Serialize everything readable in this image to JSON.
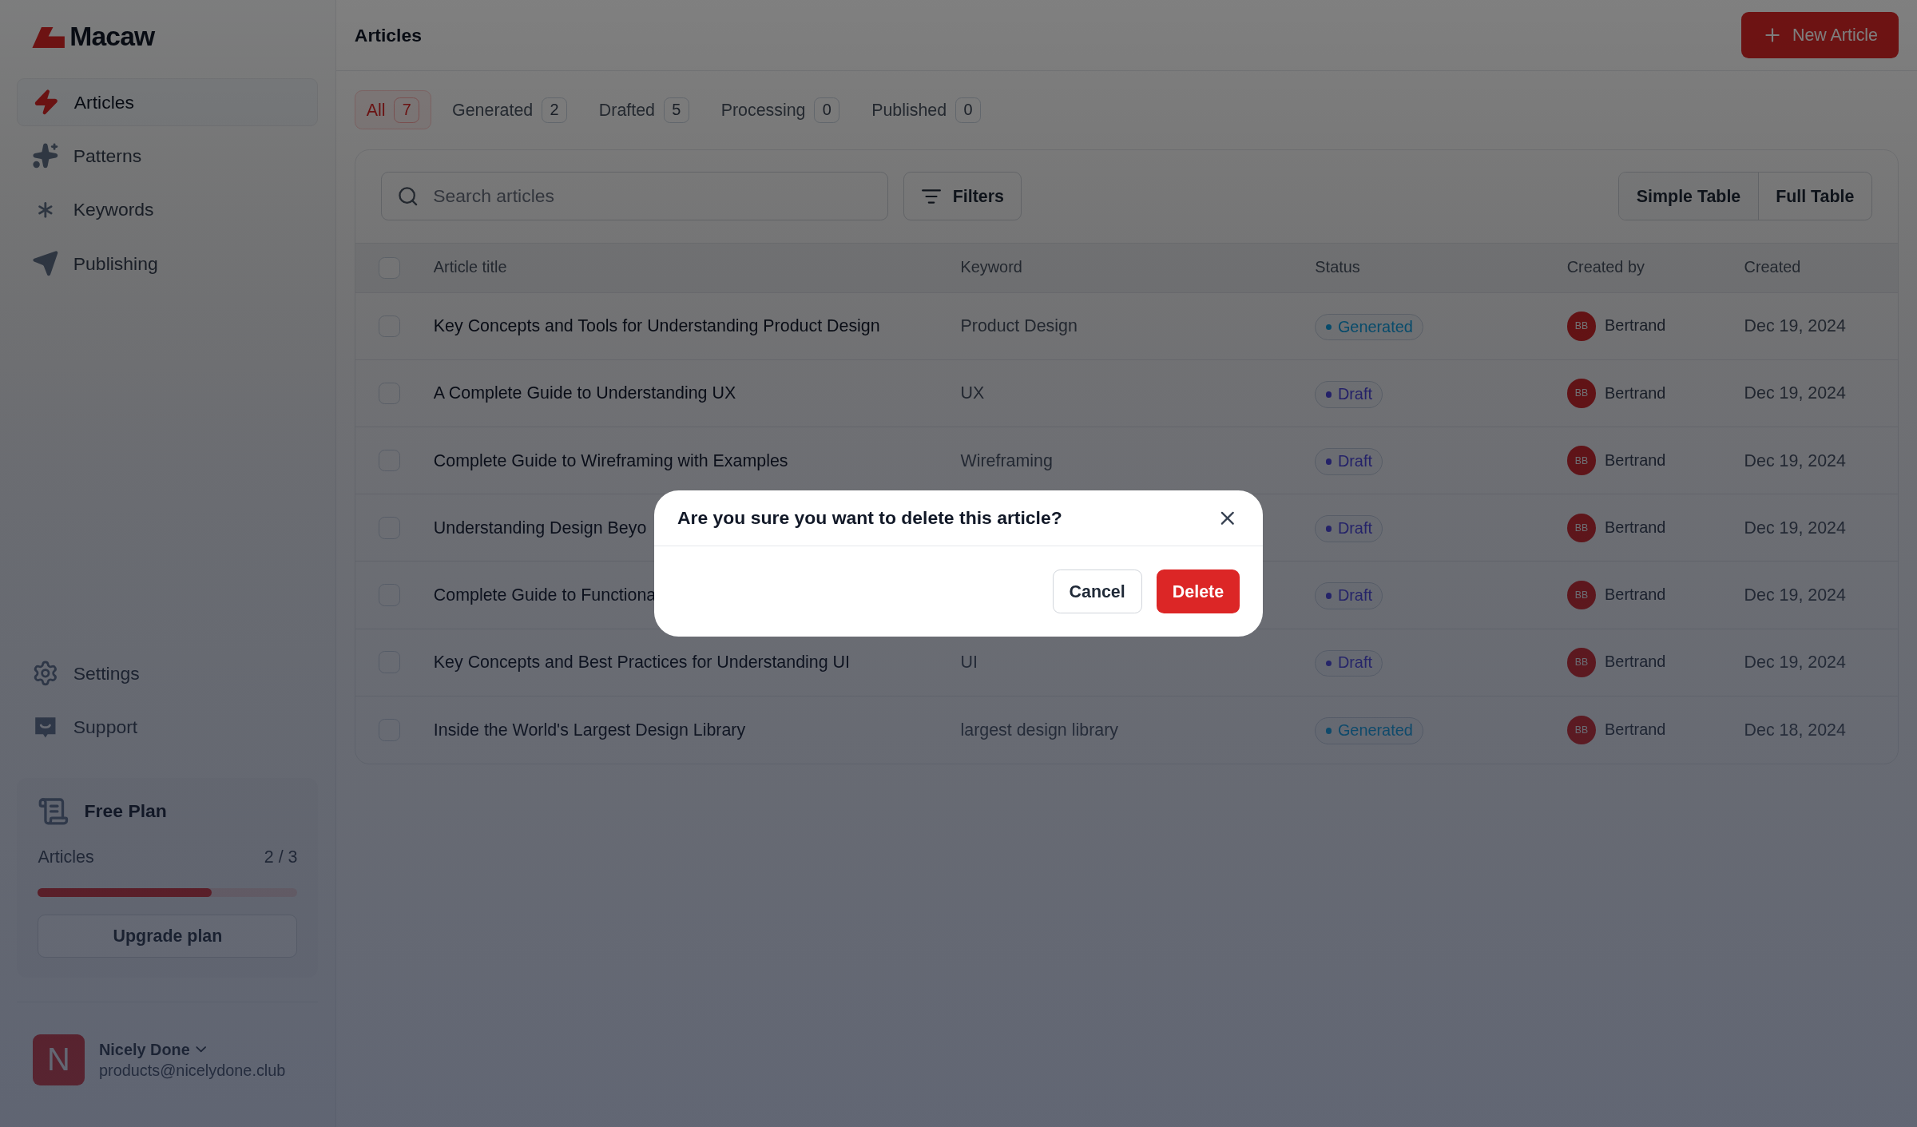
{
  "sidebar": {
    "logo": "Macaw",
    "nav": [
      {
        "label": "Articles",
        "selected": true
      },
      {
        "label": "Patterns",
        "selected": false
      },
      {
        "label": "Keywords",
        "selected": false
      },
      {
        "label": "Publishing",
        "selected": false
      }
    ],
    "bottom_nav": [
      {
        "label": "Settings"
      },
      {
        "label": "Support"
      }
    ],
    "plan": {
      "title": "Free Plan",
      "label": "Articles",
      "count": "2 / 3",
      "level": 0.67,
      "button": "Upgrade plan"
    },
    "user": {
      "initial": "N",
      "name": "Nicely Done",
      "email": "products@nicelydone.club"
    }
  },
  "header": {
    "title": "Articles",
    "button": "New Article"
  },
  "tabs": [
    {
      "label": "All",
      "count": "7",
      "selected": true
    },
    {
      "label": "Generated",
      "count": "2",
      "selected": false
    },
    {
      "label": "Drafted",
      "count": "5",
      "selected": false
    },
    {
      "label": "Processing",
      "count": "0",
      "selected": false
    },
    {
      "label": "Published",
      "count": "0",
      "selected": false
    }
  ],
  "search": {
    "placeholder": "Search articles"
  },
  "filters_button": "Filters",
  "view_toggle": [
    "Simple Table",
    "Full Table"
  ],
  "table": {
    "header_checked": false,
    "columns": [
      "Article title",
      "Keyword",
      "Status",
      "Created by",
      "Created"
    ],
    "rows": [
      {
        "checked": false,
        "title": "Key Concepts and Tools for Understanding Product Design",
        "keyword": "Product Design",
        "status": {
          "label": "Generated",
          "kind": "generated"
        },
        "initials": "BB",
        "created_by": "Bertrand",
        "created": "Dec 19, 2024"
      },
      {
        "checked": false,
        "title": "A Complete Guide to Understanding UX",
        "keyword": "UX",
        "status": {
          "label": "Draft",
          "kind": "draft"
        },
        "initials": "BB",
        "created_by": "Bertrand",
        "created": "Dec 19, 2024"
      },
      {
        "checked": false,
        "title": "Complete Guide to Wireframing with Examples",
        "keyword": "Wireframing",
        "status": {
          "label": "Draft",
          "kind": "draft"
        },
        "initials": "BB",
        "created_by": "Bertrand",
        "created": "Dec 19, 2024"
      },
      {
        "checked": false,
        "title": "Understanding Design Beyo",
        "status": {
          "label": "Draft",
          "kind": "draft"
        },
        "initials": "BB",
        "created_by": "Bertrand",
        "created": "Dec 19, 2024"
      },
      {
        "checked": false,
        "title": "Complete Guide to Functiona",
        "status": {
          "label": "Draft",
          "kind": "draft"
        },
        "initials": "BB",
        "created_by": "Bertrand",
        "created": "Dec 19, 2024"
      },
      {
        "checked": false,
        "title": "Key Concepts and Best Practices for Understanding UI",
        "keyword": "UI",
        "status": {
          "label": "Draft",
          "kind": "draft"
        },
        "initials": "BB",
        "created_by": "Bertrand",
        "created": "Dec 19, 2024"
      },
      {
        "checked": false,
        "title": "Inside the World's Largest Design Library",
        "keyword": "largest design library",
        "status": {
          "label": "Generated",
          "kind": "generated"
        },
        "initials": "BB",
        "created_by": "Bertrand",
        "created": "Dec 18, 2024"
      }
    ]
  },
  "dialog": {
    "title": "Are you sure you want to delete this article?",
    "buttons": [
      {
        "label": "Cancel",
        "kind": "secondary"
      },
      {
        "label": "Delete",
        "kind": "danger"
      }
    ]
  }
}
